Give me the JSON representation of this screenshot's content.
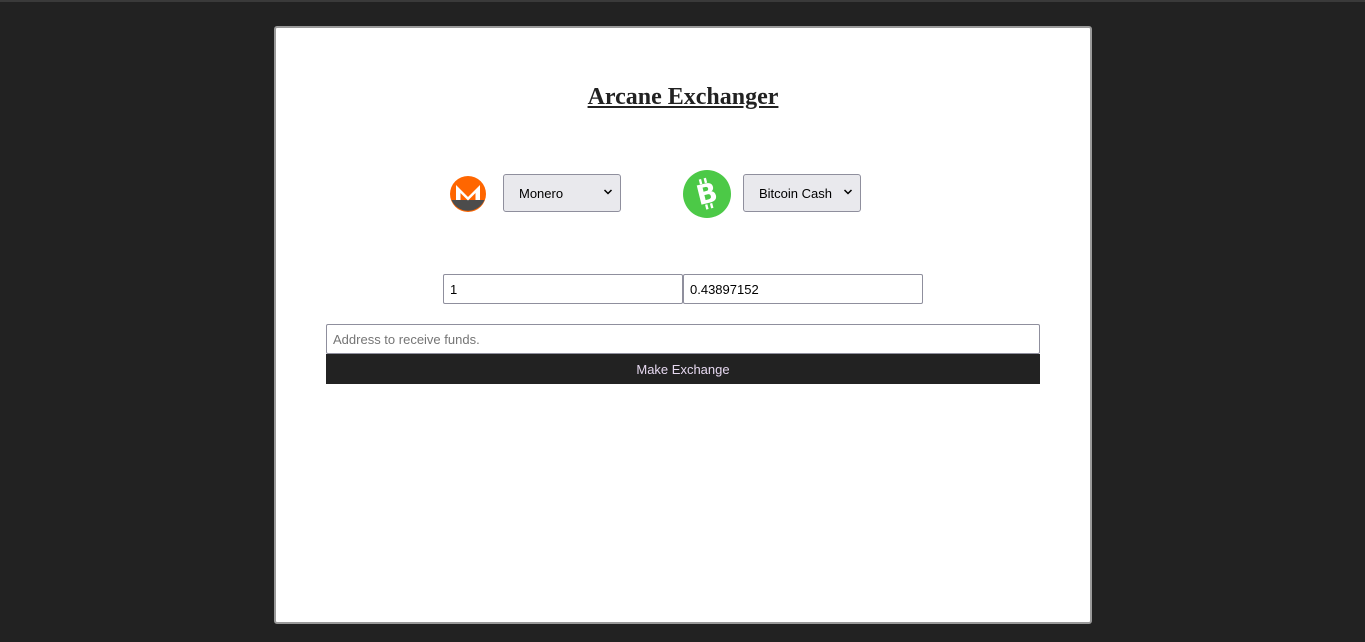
{
  "app": {
    "title": "Arcane Exchanger"
  },
  "exchange": {
    "from": {
      "currency": "Monero",
      "icon": "monero-icon",
      "icon_color": "#ff6600",
      "amount": "1"
    },
    "to": {
      "currency": "Bitcoin Cash",
      "icon": "bitcoin-cash-icon",
      "icon_color": "#4cc947",
      "amount": "0.43897152"
    },
    "address": {
      "value": "",
      "placeholder": "Address to receive funds."
    },
    "submit_label": "Make Exchange"
  },
  "colors": {
    "background": "#222222",
    "card": "#ffffff",
    "button": "#222222",
    "button_text": "#e6d8f0"
  }
}
